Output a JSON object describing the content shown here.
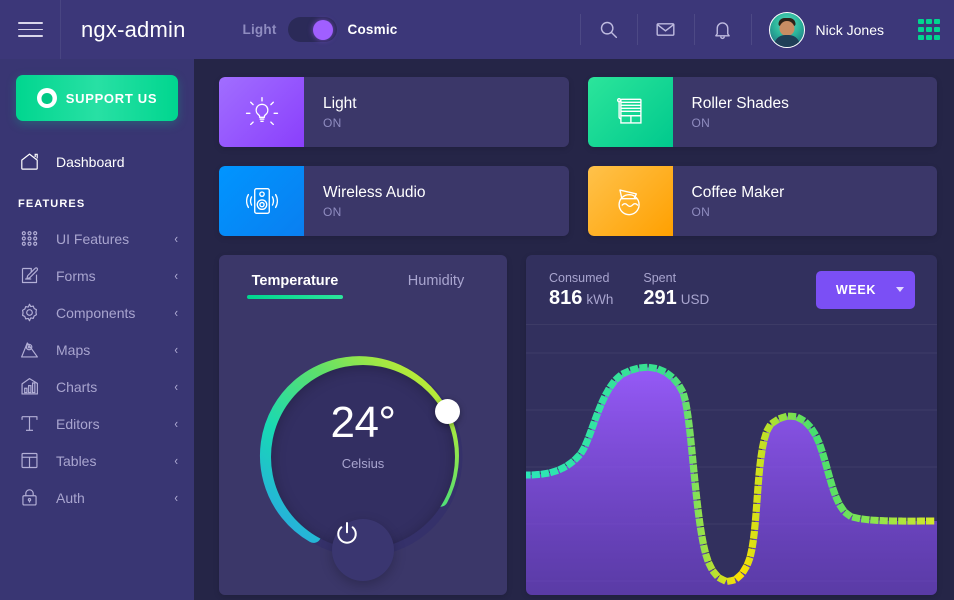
{
  "header": {
    "menu_icon": "hamburger-icon",
    "brand": "ngx-admin",
    "theme": {
      "left_label": "Light",
      "right_label": "Cosmic",
      "selected": "Cosmic"
    },
    "icons": [
      "search-icon",
      "email-icon",
      "bell-icon",
      "grid-icon"
    ],
    "user": {
      "name": "Nick Jones"
    }
  },
  "sidebar": {
    "support_button": "SUPPORT US",
    "dashboard": {
      "label": "Dashboard",
      "icon": "home-icon"
    },
    "section_label": "FEATURES",
    "items": [
      {
        "label": "UI Features",
        "icon": "dots-grid-icon",
        "chevron": "‹"
      },
      {
        "label": "Forms",
        "icon": "form-edit-icon",
        "chevron": "‹"
      },
      {
        "label": "Components",
        "icon": "gear-icon",
        "chevron": "‹"
      },
      {
        "label": "Maps",
        "icon": "map-pin-icon",
        "chevron": "‹"
      },
      {
        "label": "Charts",
        "icon": "bar-chart-icon",
        "chevron": "‹"
      },
      {
        "label": "Editors",
        "icon": "text-editor-icon",
        "chevron": "‹"
      },
      {
        "label": "Tables",
        "icon": "table-icon",
        "chevron": "‹"
      },
      {
        "label": "Auth",
        "icon": "lock-icon",
        "chevron": "‹"
      }
    ]
  },
  "devices": [
    {
      "name": "Light",
      "status": "ON",
      "icon": "light-bulb-icon",
      "accent": "#a16eff"
    },
    {
      "name": "Roller Shades",
      "status": "ON",
      "icon": "roller-shades-icon",
      "accent": "#2ce59b"
    },
    {
      "name": "Wireless Audio",
      "status": "ON",
      "icon": "speaker-icon",
      "accent": "#0095ff"
    },
    {
      "name": "Coffee Maker",
      "status": "ON",
      "icon": "coffee-pot-icon",
      "accent": "#ffc24b"
    }
  ],
  "temperature": {
    "tabs": [
      {
        "label": "Temperature",
        "active": true
      },
      {
        "label": "Humidity",
        "active": false
      }
    ],
    "value": "24°",
    "unit": "Celsius",
    "power_icon": "power-icon",
    "accent": "#00d68f"
  },
  "electricity": {
    "consumed": {
      "caption": "Consumed",
      "value": "816",
      "unit": "kWh"
    },
    "spent": {
      "caption": "Spent",
      "value": "291",
      "unit": "USD"
    },
    "period": {
      "label": "WEEK",
      "caret_icon": "chevron-down-icon",
      "color": "#7b4ff5"
    }
  },
  "chart_data": {
    "type": "area",
    "title": "",
    "xlabel": "",
    "ylabel": "",
    "grid": true,
    "legend": null,
    "line_style": "dotted",
    "line_color_gradient": [
      "#2ce5b8",
      "#66e84f",
      "#ffe000"
    ],
    "area_fill": "#8a4ff0",
    "ylim": [
      0,
      100
    ],
    "gridlines_y": [
      0,
      20,
      40,
      60,
      80,
      100
    ],
    "x": [
      0,
      4,
      8,
      12,
      16,
      20,
      24,
      28,
      32,
      36,
      40,
      44,
      48,
      52,
      56,
      60,
      64,
      68,
      72,
      76,
      80,
      84,
      88,
      92,
      96,
      100
    ],
    "values": [
      41,
      41,
      42,
      43,
      45,
      49,
      56,
      67,
      79,
      88,
      93,
      94,
      93,
      85,
      55,
      18,
      5,
      4,
      12,
      40,
      64,
      73,
      74,
      71,
      52,
      33,
      28,
      28,
      28,
      28
    ]
  }
}
